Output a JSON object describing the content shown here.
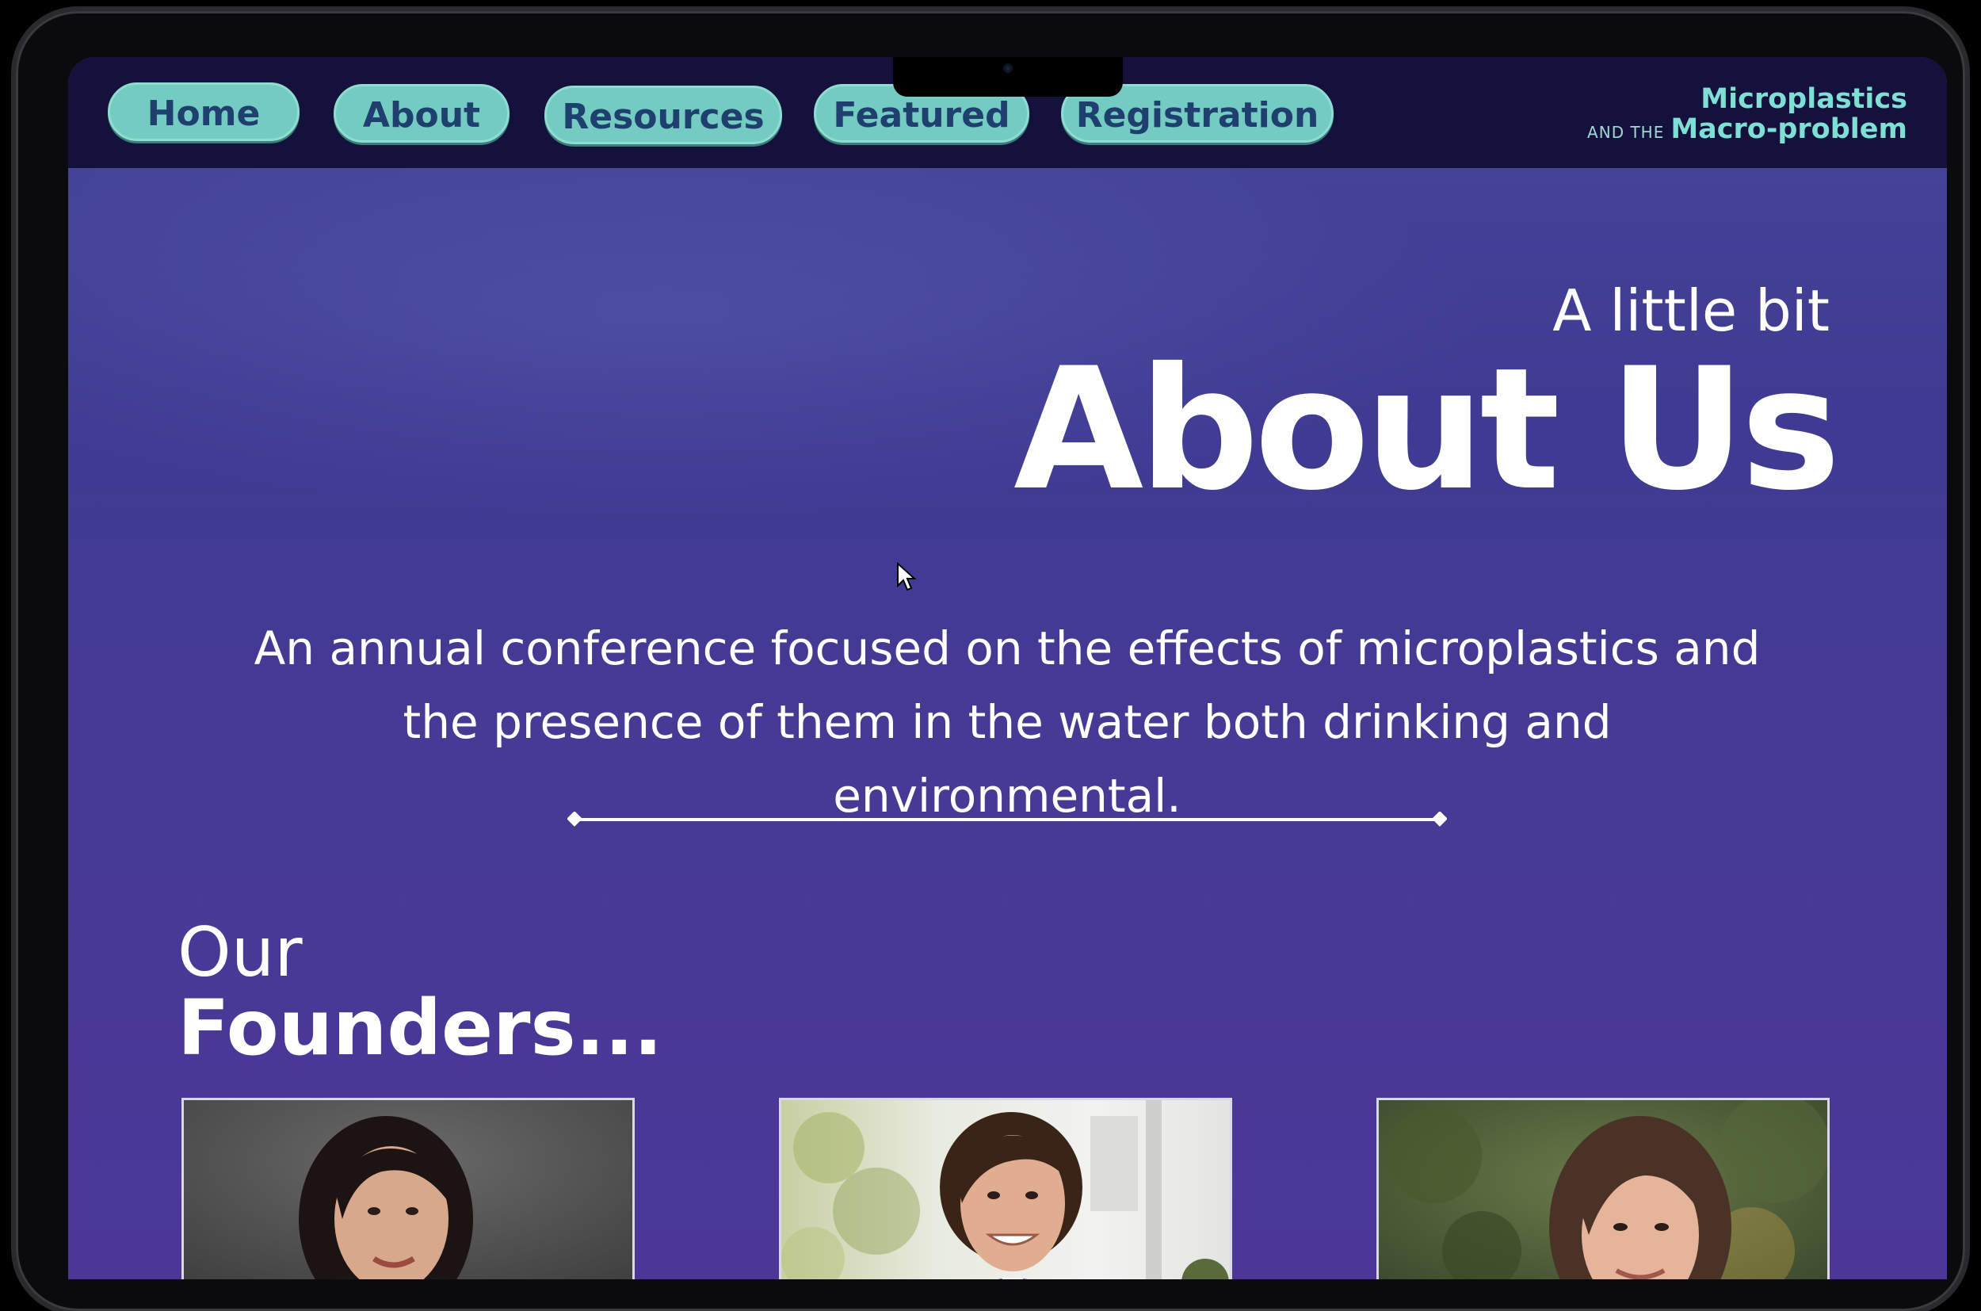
{
  "nav": {
    "items": [
      {
        "label": "Home"
      },
      {
        "label": "About"
      },
      {
        "label": "Resources"
      },
      {
        "label": "Featured"
      },
      {
        "label": "Registration"
      }
    ]
  },
  "brand": {
    "line1": "Microplastics",
    "small": "AND THE",
    "line2": "Macro-problem"
  },
  "hero": {
    "subtitle": "A little bit",
    "title": "About Us"
  },
  "description": "An annual conference focused on the effects of microplastics and the presence of them in the water both drinking and environmental.",
  "founders": {
    "heading_top": "Our",
    "heading_bottom": "Founders..."
  },
  "colors": {
    "accent": "#73cbc1",
    "nav_text": "#1f3f6e",
    "topbar": "#14113c",
    "background": "#46479a"
  }
}
